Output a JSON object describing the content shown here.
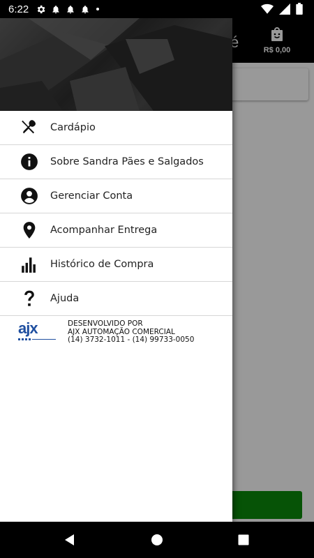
{
  "status_bar": {
    "time": "6:22",
    "left_icons": [
      "gear-icon",
      "bell-icon",
      "bell-icon",
      "bell-icon",
      "dot-icon"
    ],
    "right_icons": [
      "wifi-icon",
      "cell-signal-icon",
      "battery-icon"
    ]
  },
  "app": {
    "toolbar_partial_text": "é",
    "cart_label": "R$ 0,00",
    "accent_color": "#0a8a0a"
  },
  "drawer": {
    "menu": [
      {
        "label": "Cardápio",
        "icon": "fork-knife-icon"
      },
      {
        "label": "Sobre Sandra Pães e Salgados",
        "icon": "info-icon"
      },
      {
        "label": "Gerenciar Conta",
        "icon": "account-circle-icon"
      },
      {
        "label": "Acompanhar Entrega",
        "icon": "location-pin-icon"
      },
      {
        "label": "Histórico de Compra",
        "icon": "bar-chart-icon"
      },
      {
        "label": "Ajuda",
        "icon": "question-mark-icon"
      }
    ],
    "footer": {
      "logo_text": "ajx",
      "line1": "DESENVOLVIDO POR",
      "line2": "AJX AUTOMAÇÃO COMERCIAL",
      "line3": "(14) 3732-1011 - (14) 99733-0050"
    }
  },
  "nav_bar": {
    "buttons": [
      "back-icon",
      "home-icon",
      "recents-icon"
    ]
  }
}
